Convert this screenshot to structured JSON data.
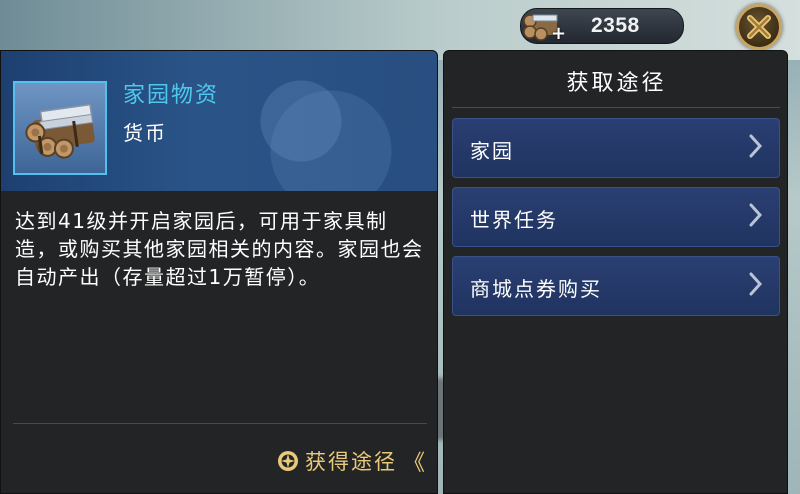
{
  "topbar": {
    "resource_value": "2358",
    "resource_plus": "+",
    "resource_icon": "timber-bundle-icon",
    "close_icon": "close-icon"
  },
  "item": {
    "name": "家园物资",
    "type": "货币",
    "icon": "timber-bundle-icon",
    "description": "达到41级并开启家园后，可用于家具制造，或购买其他家园相关的内容。家园也会自动产出（存量超过1万暂停）。",
    "obtain_label": "获得途径",
    "obtain_chevron": "《"
  },
  "sources": {
    "title": "获取途径",
    "items": [
      {
        "label": "家园"
      },
      {
        "label": "世界任务"
      },
      {
        "label": "商城点券购买"
      }
    ]
  },
  "colors": {
    "item_name": "#4fc8ee",
    "obtain_link": "#e9c97a",
    "source_button": "#2a3f72",
    "panel_bg": "#232426"
  }
}
